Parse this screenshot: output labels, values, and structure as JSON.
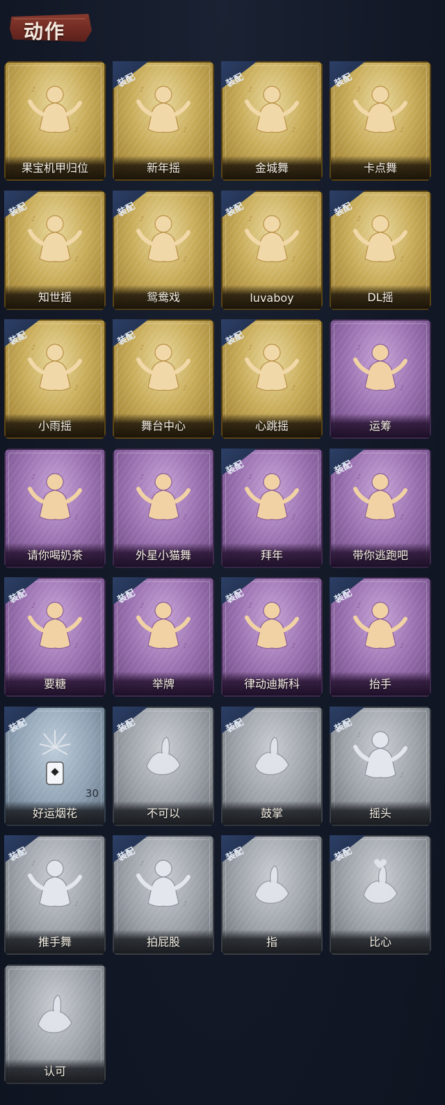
{
  "header": {
    "title": "动作"
  },
  "equip_label": "装配",
  "colors": {
    "gold": "#c9ad5a",
    "purple": "#9a70b0",
    "blue": "#8ea1b3",
    "gray": "#9a9fa6",
    "badge": "#2c3f66"
  },
  "items": [
    {
      "label": "果宝机甲归位",
      "tier": "gold",
      "equipped": false,
      "icon": "dance-figure-icon"
    },
    {
      "label": "新年摇",
      "tier": "gold",
      "equipped": true,
      "icon": "dance-figure-icon"
    },
    {
      "label": "金城舞",
      "tier": "gold",
      "equipped": true,
      "icon": "dance-figure-icon"
    },
    {
      "label": "卡点舞",
      "tier": "gold",
      "equipped": true,
      "icon": "dance-figure-icon"
    },
    {
      "label": "知世摇",
      "tier": "gold",
      "equipped": true,
      "icon": "dance-figure-icon"
    },
    {
      "label": "鸳鸯戏",
      "tier": "gold",
      "equipped": true,
      "icon": "dance-figure-icon"
    },
    {
      "label": "luvaboy",
      "tier": "gold",
      "equipped": true,
      "icon": "dance-figure-icon"
    },
    {
      "label": "DL摇",
      "tier": "gold",
      "equipped": true,
      "icon": "dance-figure-icon"
    },
    {
      "label": "小雨摇",
      "tier": "gold",
      "equipped": true,
      "icon": "dance-figure-icon"
    },
    {
      "label": "舞台中心",
      "tier": "gold",
      "equipped": true,
      "icon": "dance-figure-icon"
    },
    {
      "label": "心跳摇",
      "tier": "gold",
      "equipped": true,
      "icon": "dance-figure-icon"
    },
    {
      "label": "运筹",
      "tier": "purple",
      "equipped": false,
      "icon": "fan-figure-icon"
    },
    {
      "label": "请你喝奶茶",
      "tier": "purple",
      "equipped": false,
      "icon": "sign-figure-icon"
    },
    {
      "label": "外星小猫舞",
      "tier": "purple",
      "equipped": false,
      "icon": "dance-figure-icon"
    },
    {
      "label": "拜年",
      "tier": "purple",
      "equipped": true,
      "icon": "bow-figure-icon"
    },
    {
      "label": "带你逃跑吧",
      "tier": "purple",
      "equipped": true,
      "icon": "dance-figure-icon"
    },
    {
      "label": "要糖",
      "tier": "purple",
      "equipped": true,
      "icon": "figure-icon"
    },
    {
      "label": "举牌",
      "tier": "purple",
      "equipped": true,
      "icon": "sign-figure-icon"
    },
    {
      "label": "律动迪斯科",
      "tier": "purple",
      "equipped": true,
      "icon": "dance-figure-icon"
    },
    {
      "label": "抬手",
      "tier": "purple",
      "equipped": true,
      "icon": "figure-icon"
    },
    {
      "label": "好运烟花",
      "tier": "blue",
      "equipped": true,
      "icon": "firework-icon",
      "count": "30"
    },
    {
      "label": "不可以",
      "tier": "gray",
      "equipped": true,
      "icon": "finger-wag-icon"
    },
    {
      "label": "鼓掌",
      "tier": "gray",
      "equipped": true,
      "icon": "clap-icon"
    },
    {
      "label": "摇头",
      "tier": "gray",
      "equipped": true,
      "icon": "figure-icon"
    },
    {
      "label": "推手舞",
      "tier": "gray",
      "equipped": true,
      "icon": "figure-icon"
    },
    {
      "label": "拍屁股",
      "tier": "gray",
      "equipped": true,
      "icon": "figure-icon"
    },
    {
      "label": "指",
      "tier": "gray",
      "equipped": true,
      "icon": "point-hand-icon"
    },
    {
      "label": "比心",
      "tier": "gray",
      "equipped": true,
      "icon": "heart-hand-icon"
    },
    {
      "label": "认可",
      "tier": "gray",
      "equipped": false,
      "icon": "thumbs-up-icon"
    }
  ]
}
